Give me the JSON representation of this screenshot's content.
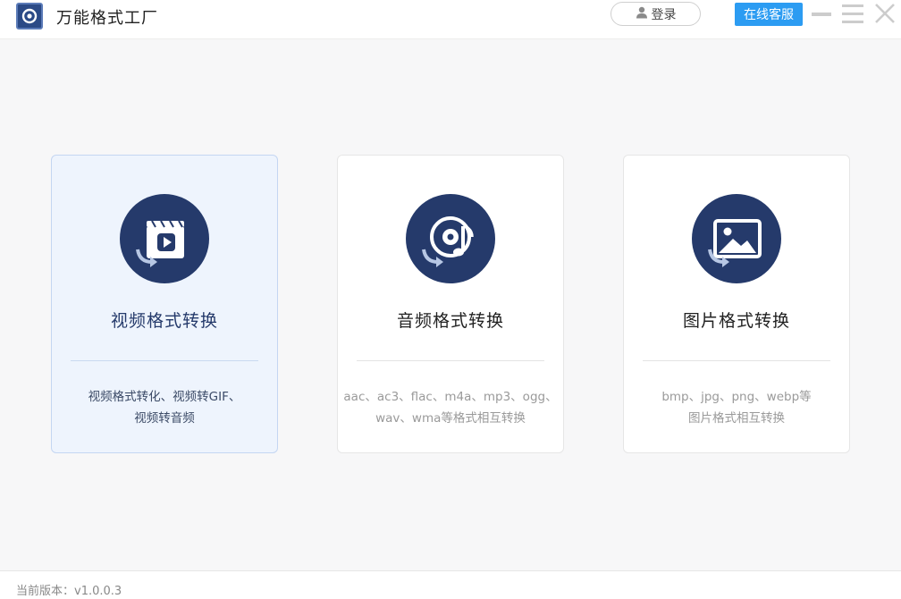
{
  "app": {
    "title": "万能格式工厂",
    "logo_icon": "app-logo-icon"
  },
  "header": {
    "login_label": "登录",
    "service_label": "在线客服"
  },
  "window_controls": [
    "minimize-icon",
    "menu-icon",
    "close-icon"
  ],
  "cards": [
    {
      "title": "视频格式转换",
      "icon": "video-convert-icon",
      "desc_line1": "视频格式转化、视频转GIF、",
      "desc_line2": "视频转音频",
      "active": true
    },
    {
      "title": "音频格式转换",
      "icon": "audio-convert-icon",
      "desc_line1": "aac、ac3、flac、m4a、mp3、ogg、",
      "desc_line2": "wav、wma等格式相互转换",
      "active": false
    },
    {
      "title": "图片格式转换",
      "icon": "image-convert-icon",
      "desc_line1": "bmp、jpg、png、webp等",
      "desc_line2": "图片格式相互转换",
      "active": false
    }
  ],
  "footer": {
    "version_text": "当前版本：v1.0.0.3"
  },
  "colors": {
    "accent": "#2c9cf2",
    "icon_bg": "#253a6b",
    "active_card_bg": "#eef4fd"
  }
}
